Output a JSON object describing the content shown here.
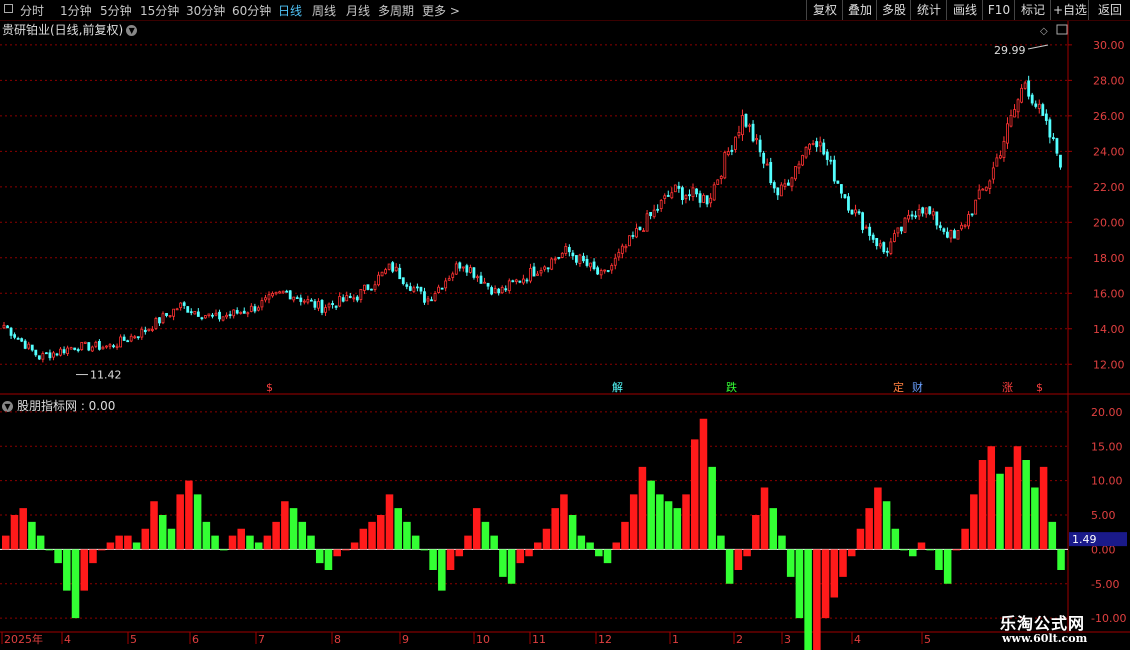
{
  "toolbar": {
    "left_items": [
      "分时",
      "1分钟",
      "5分钟",
      "15分钟",
      "30分钟",
      "60分钟",
      "日线",
      "周线",
      "月线",
      "多周期",
      "更多 >"
    ],
    "active_item": "日线",
    "right_items": [
      "复权",
      "叠加",
      "多股",
      "统计",
      "画线",
      "F10",
      "标记",
      "+自选",
      "返回"
    ]
  },
  "stock": {
    "title": "贵研铂业(日线,前复权)",
    "high_label": "29.99",
    "low_label": "11.42"
  },
  "indicator": {
    "title": "股朋指标网 : 0.00",
    "current_value": "1.49"
  },
  "event_markers": [
    "$",
    "解",
    "跌",
    "定",
    "财",
    "涨",
    "$"
  ],
  "price_axis": [
    "30.00",
    "28.00",
    "26.00",
    "24.00",
    "22.00",
    "20.00",
    "18.00",
    "16.00",
    "14.00",
    "12.00"
  ],
  "indicator_axis": [
    "20.00",
    "15.00",
    "10.00",
    "5.00",
    "0.00",
    "-5.00",
    "-10.00"
  ],
  "date_axis": [
    "2025年",
    "4",
    "5",
    "6",
    "7",
    "8",
    "9",
    "10",
    "11",
    "12",
    "1",
    "2",
    "3",
    "4",
    "5"
  ],
  "watermark": {
    "line1": "乐淘公式网",
    "line2": "www.60lt.com"
  },
  "colors": {
    "up": "#ff3333",
    "down": "#54ffff",
    "ind_up": "#ff1a1a",
    "ind_down": "#33ff33",
    "grid": "#8b0000",
    "axis_text": "#e04040"
  },
  "chart_data": [
    {
      "type": "candlestick",
      "title": "贵研铂业(日线,前复权)",
      "x_range": [
        "2025-03",
        "2026-05"
      ],
      "ylim": [
        11,
        30.5
      ],
      "annotations": [
        {
          "label": "29.99",
          "type": "high"
        },
        {
          "label": "11.42",
          "type": "low"
        }
      ],
      "close_trend": [
        {
          "x": "2025-03",
          "y": 14.2
        },
        {
          "x": "2025-04a",
          "y": 12.4
        },
        {
          "x": "2025-04b",
          "y": 13.0
        },
        {
          "x": "2025-05a",
          "y": 13.0
        },
        {
          "x": "2025-05b",
          "y": 13.9
        },
        {
          "x": "2025-06a",
          "y": 15.3
        },
        {
          "x": "2025-06b",
          "y": 14.6
        },
        {
          "x": "2025-07a",
          "y": 15.1
        },
        {
          "x": "2025-07b",
          "y": 16.1
        },
        {
          "x": "2025-08a",
          "y": 15.2
        },
        {
          "x": "2025-08b",
          "y": 15.8
        },
        {
          "x": "2025-09a",
          "y": 17.5
        },
        {
          "x": "2025-09b",
          "y": 15.6
        },
        {
          "x": "2025-10a",
          "y": 17.8
        },
        {
          "x": "2025-10b",
          "y": 16.0
        },
        {
          "x": "2025-11a",
          "y": 17.2
        },
        {
          "x": "2025-11b",
          "y": 18.4
        },
        {
          "x": "2025-12a",
          "y": 16.9
        },
        {
          "x": "2025-12b",
          "y": 19.5
        },
        {
          "x": "2026-01a",
          "y": 21.8
        },
        {
          "x": "2026-01b",
          "y": 21.3
        },
        {
          "x": "2026-02a",
          "y": 26.0
        },
        {
          "x": "2026-02b",
          "y": 21.5
        },
        {
          "x": "2026-03a",
          "y": 25.0
        },
        {
          "x": "2026-03b",
          "y": 21.0
        },
        {
          "x": "2026-04a",
          "y": 18.3
        },
        {
          "x": "2026-04b",
          "y": 21.0
        },
        {
          "x": "2026-05a",
          "y": 19.0
        },
        {
          "x": "2026-05b",
          "y": 22.5
        },
        {
          "x": "2026-06a",
          "y": 28.0
        },
        {
          "x": "2026-06b",
          "y": 23.5
        }
      ]
    },
    {
      "type": "bar",
      "title": "股朋指标网",
      "ylim": [
        -11,
        21
      ],
      "last_value": 1.49,
      "values": [
        2,
        5,
        6,
        4,
        2,
        0,
        -2,
        -6,
        -10,
        -6,
        -2,
        0,
        1,
        2,
        2,
        1,
        3,
        7,
        5,
        3,
        8,
        10,
        8,
        4,
        2,
        0,
        2,
        3,
        2,
        1,
        2,
        4,
        7,
        6,
        4,
        2,
        -2,
        -3,
        -1,
        0,
        1,
        3,
        4,
        5,
        8,
        6,
        4,
        2,
        0,
        -3,
        -6,
        -3,
        -1,
        2,
        6,
        4,
        2,
        -4,
        -5,
        -2,
        -1,
        1,
        3,
        6,
        8,
        5,
        2,
        1,
        -1,
        -2,
        1,
        4,
        8,
        12,
        10,
        8,
        7,
        6,
        8,
        16,
        19,
        12,
        2,
        -5,
        -3,
        -1,
        5,
        9,
        6,
        2,
        -4,
        -10,
        -16,
        -15,
        -10,
        -7,
        -4,
        -1,
        3,
        6,
        9,
        7,
        3,
        0,
        -1,
        1,
        0,
        -3,
        -5,
        0,
        3,
        8,
        13,
        15,
        11,
        12,
        15,
        13,
        9,
        12,
        4,
        -3
      ]
    }
  ]
}
